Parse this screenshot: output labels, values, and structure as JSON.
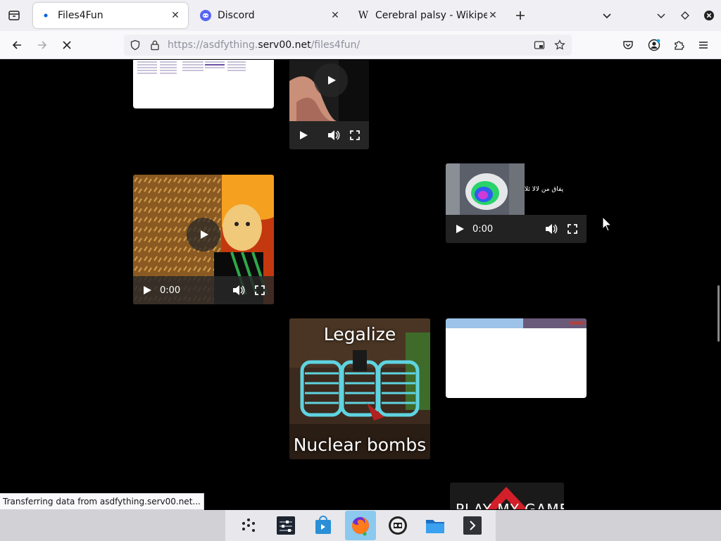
{
  "browser": {
    "tabs": [
      {
        "title": "Files4Fun",
        "active": true,
        "favicon": "blue-dot-icon"
      },
      {
        "title": "Discord",
        "active": false,
        "favicon": "discord-icon"
      },
      {
        "title": "Cerebral palsy - Wikipedia",
        "active": false,
        "favicon": "wikipedia-w-icon"
      }
    ],
    "url": {
      "prefix": "https://asdfything.",
      "host": "serv00.net",
      "path": "/files4fun/"
    },
    "favicon_text": "W"
  },
  "content": {
    "videos": [
      {
        "time": ""
      },
      {
        "time": "0:00"
      },
      {
        "time": "0:00",
        "caption": "پفاق من لالا ئلا"
      }
    ],
    "meme": {
      "top_text": "Legalize",
      "bottom_text": "Nuclear bombs"
    },
    "game_banner": "PLAY MY GAME"
  },
  "status": {
    "text": "Transferring data from asdfything.serv00.net..."
  },
  "taskbar": {
    "items": [
      "app-launcher-icon",
      "mixer-icon",
      "store-icon",
      "firefox-icon",
      "media-icon",
      "files-icon",
      "terminal-icon"
    ]
  },
  "colors": {
    "accent": "#0061e0",
    "dock_active": "#8cc9ee",
    "discord": "#5865f2"
  }
}
